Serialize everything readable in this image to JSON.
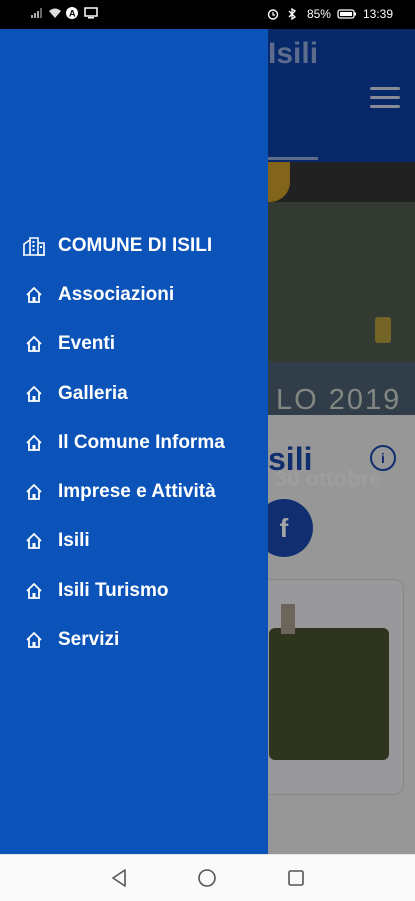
{
  "status_bar": {
    "battery": "85%",
    "time": "13:39",
    "icons": [
      "signal-icon",
      "wifi-icon",
      "nfc-icon",
      "screen-cast-icon",
      "alarm-icon",
      "bluetooth-icon",
      "battery-icon"
    ]
  },
  "app": {
    "title": "Isili",
    "banner": {
      "year_text": "LO 2019",
      "place_text": "sili",
      "date_text": "30 ottobre"
    },
    "section_heading": "sili",
    "facebook_label": "f",
    "info_label": "i"
  },
  "drawer": {
    "background_color": "#0b53b8",
    "items": [
      {
        "label": "COMUNE DI ISILI",
        "icon": "city-buildings-icon"
      },
      {
        "label": "Associazioni",
        "icon": "home-icon"
      },
      {
        "label": "Eventi",
        "icon": "home-icon"
      },
      {
        "label": "Galleria",
        "icon": "home-icon"
      },
      {
        "label": "Il Comune Informa",
        "icon": "home-icon"
      },
      {
        "label": "Imprese e Attività",
        "icon": "home-icon"
      },
      {
        "label": "Isili",
        "icon": "home-icon"
      },
      {
        "label": "Isili Turismo",
        "icon": "home-icon"
      },
      {
        "label": "Servizi",
        "icon": "home-icon"
      }
    ]
  },
  "nav_bar": {
    "buttons": [
      "back-icon",
      "home-circle-icon",
      "recents-icon"
    ]
  }
}
